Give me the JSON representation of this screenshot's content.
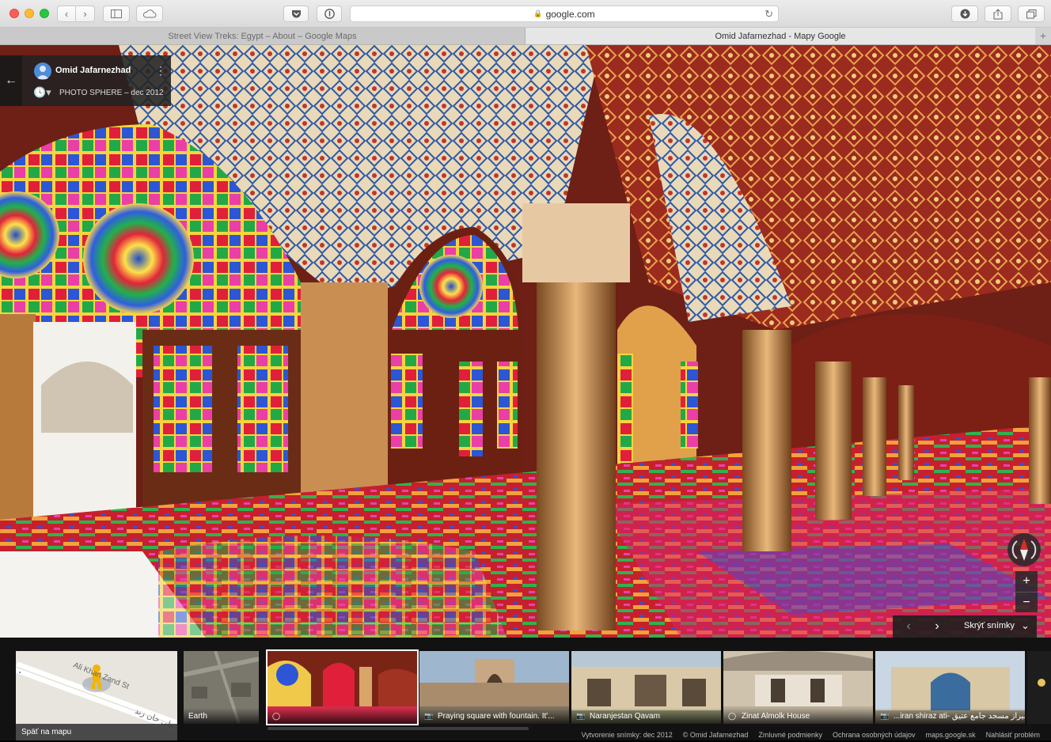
{
  "browser": {
    "url": "google.com",
    "tabs": [
      {
        "label": "Street View Treks: Egypt – About – Google Maps",
        "active": false
      },
      {
        "label": "Omid Jafarnezhad - Mapy Google",
        "active": true
      }
    ]
  },
  "panorama": {
    "owner_name": "Omid Jafarnezhad",
    "photo_meta": "PHOTO SPHERE – dec 2012"
  },
  "controls": {
    "zoom_in": "+",
    "zoom_out": "−",
    "hide_photos": "Skrýť snímky"
  },
  "filmstrip": {
    "back_to_map": "Späť na mapu",
    "map_street_label": "Ali Khan Zand St",
    "map_street_label_fa": "علی خان زند",
    "items": [
      {
        "caption": "Earth",
        "icon": "none"
      },
      {
        "caption": "",
        "icon": "photosphere-icon"
      },
      {
        "caption": "Praying square with fountain. It'...",
        "icon": "camera-icon"
      },
      {
        "caption": "Naranjestan Qavam",
        "icon": "camera-icon"
      },
      {
        "caption": "Zinat Almolk House",
        "icon": "photosphere-icon"
      },
      {
        "caption": "...iran shiraz ati- شیراز مسجد جامع عتیق",
        "icon": "camera-icon"
      }
    ]
  },
  "footer": {
    "created": "Vytvorenie snímky: dec 2012",
    "copyright": "© Omid Jafarnezhad",
    "terms": "Zmluvné podmienky",
    "privacy": "Ochrana osobných údajov",
    "domain": "maps.google.sk",
    "report": "Nahlásiť problém"
  },
  "colors": {
    "accent_blue": "#4e8bd8",
    "compass_red": "#d93025"
  }
}
